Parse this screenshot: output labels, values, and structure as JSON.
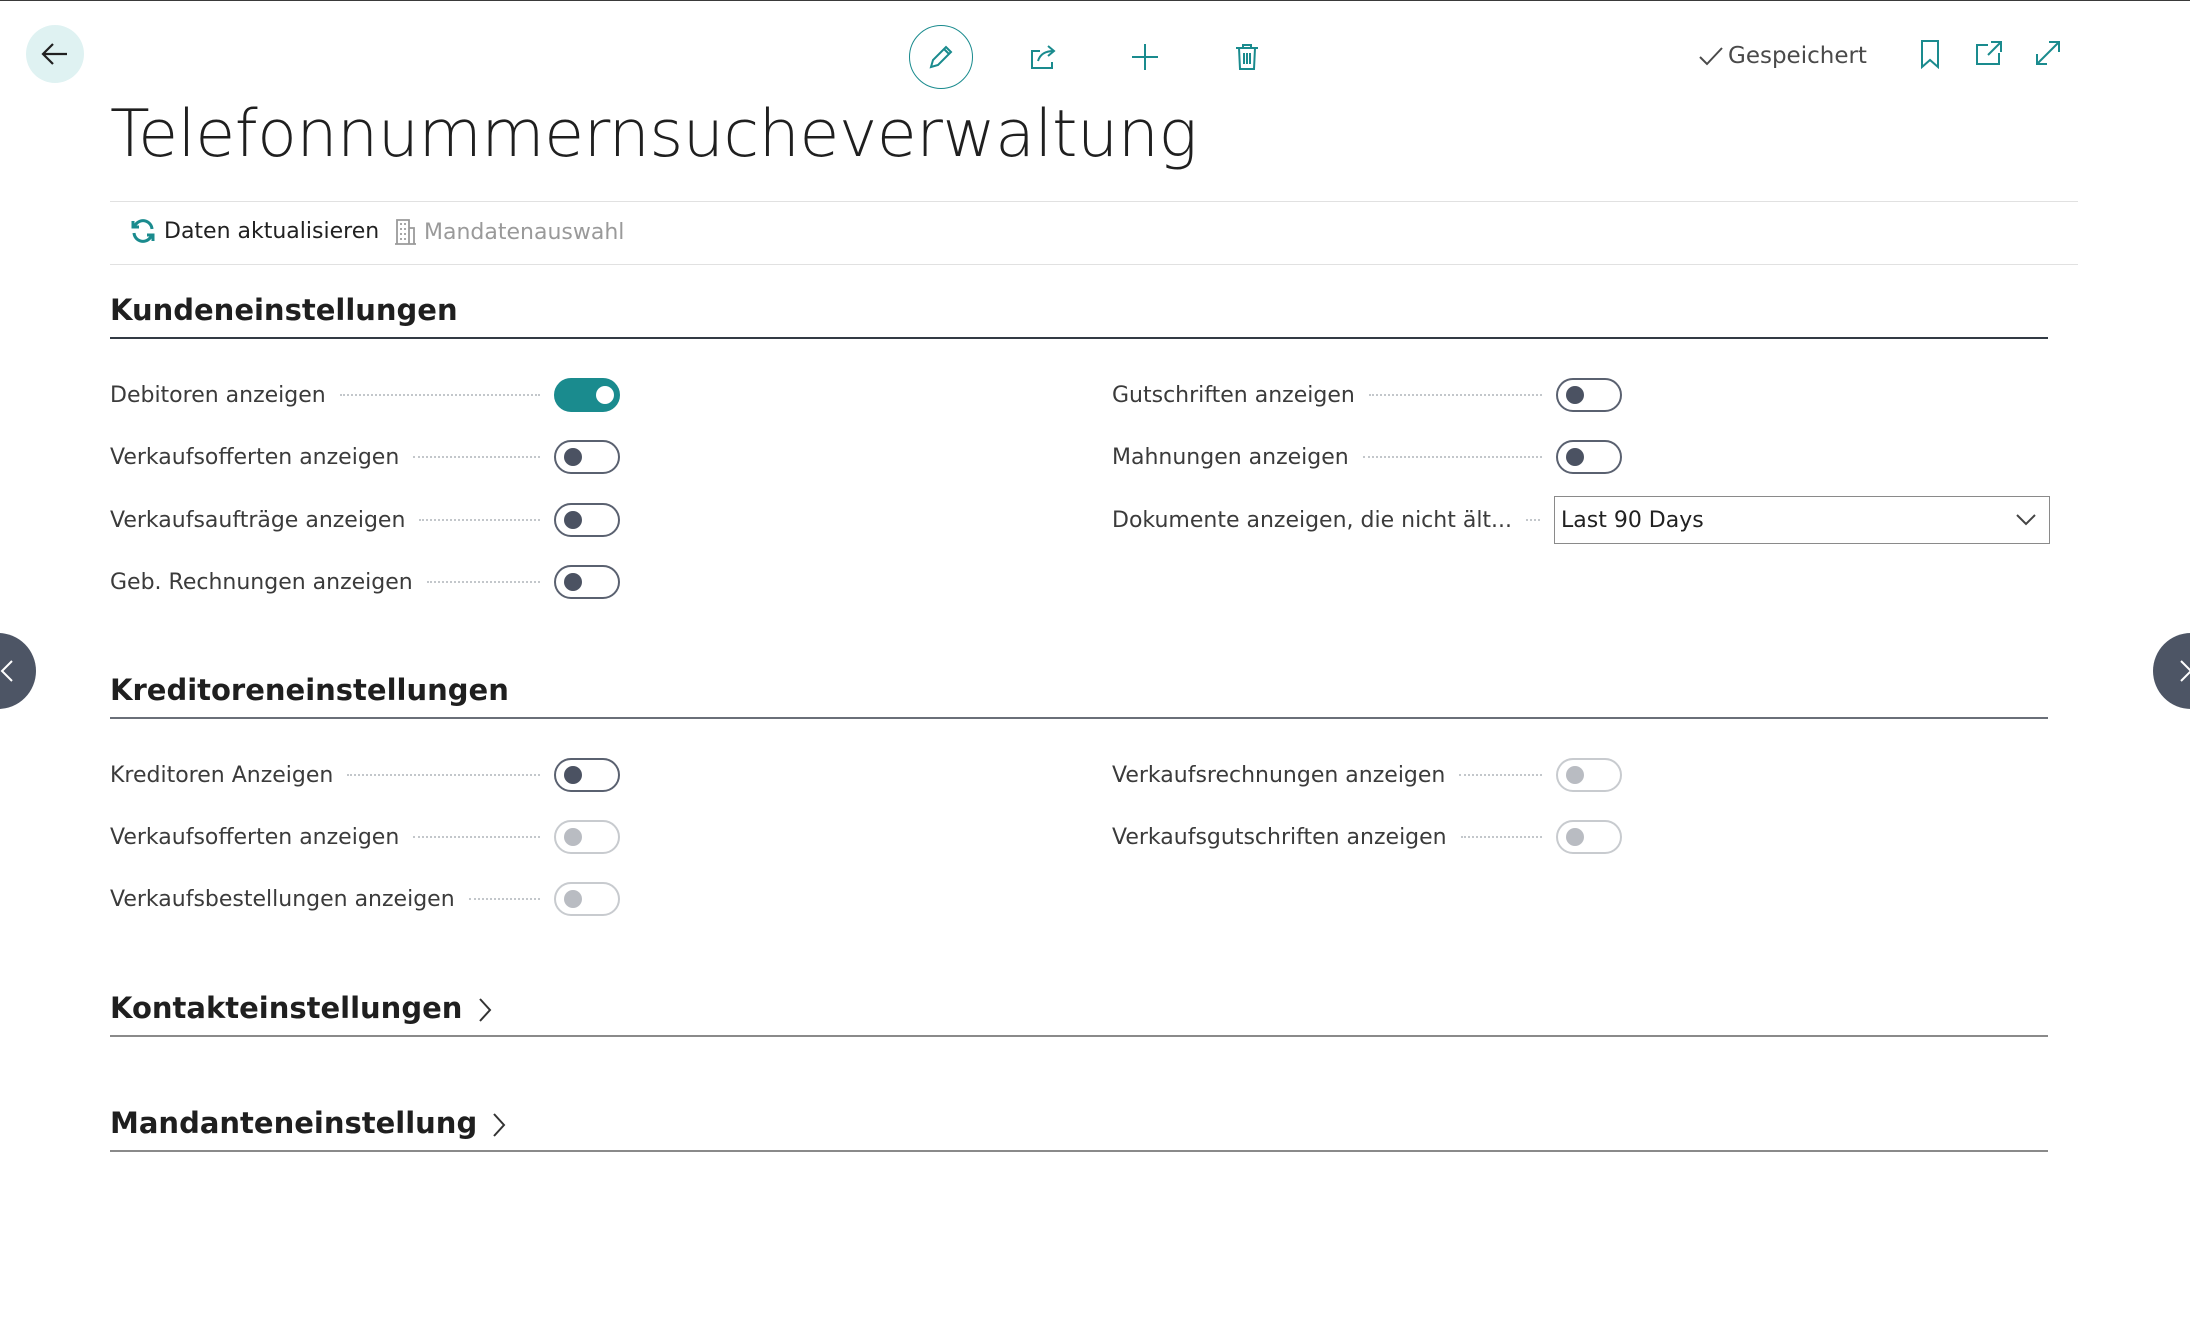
{
  "header": {
    "saved_status": "Gespeichert",
    "title": "Telefonnummernsucheverwaltung"
  },
  "actions": {
    "refresh_label": "Daten aktualisieren",
    "mandate_label": "Mandatenauswahl"
  },
  "customer_section": {
    "title": "Kundeneinstellungen",
    "left_fields": [
      {
        "label": "Debitoren anzeigen",
        "value": true
      },
      {
        "label": "Verkaufsofferten anzeigen",
        "value": false
      },
      {
        "label": "Verkaufsaufträge anzeigen",
        "value": false
      },
      {
        "label": "Geb. Rechnungen anzeigen",
        "value": false
      }
    ],
    "right_fields": [
      {
        "label": "Gutschriften anzeigen",
        "value": false
      },
      {
        "label": "Mahnungen anzeigen",
        "value": false
      }
    ],
    "documents_filter": {
      "label": "Dokumente anzeigen, die nicht ält...",
      "value": "Last 90 Days"
    }
  },
  "vendor_section": {
    "title": "Kreditoreneinstellungen",
    "left_fields": [
      {
        "label": "Kreditoren Anzeigen",
        "value": false,
        "enabled": true
      },
      {
        "label": "Verkaufsofferten anzeigen",
        "value": false,
        "enabled": false
      },
      {
        "label": "Verkaufsbestellungen anzeigen",
        "value": false,
        "enabled": false
      }
    ],
    "right_fields": [
      {
        "label": "Verkaufsrechnungen anzeigen",
        "value": false,
        "enabled": false
      },
      {
        "label": "Verkaufsgutschriften anzeigen",
        "value": false,
        "enabled": false
      }
    ]
  },
  "contact_section": {
    "title": "Kontakteinstellungen"
  },
  "mandate_section": {
    "title": "Mandanteneinstellung"
  },
  "colors": {
    "accent": "#1a8b8e",
    "toggle_off_knob": "#4b5262",
    "disabled": "#b9bcc2",
    "back_bg": "#dff2f2"
  }
}
